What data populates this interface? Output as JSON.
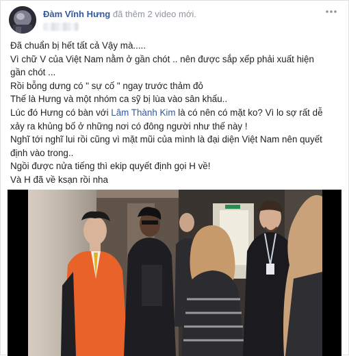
{
  "post": {
    "author": "Đàm Vĩnh Hưng",
    "action": "đã thêm 2 video mới.",
    "more_icon": "ellipsis-icon",
    "lines": {
      "l1": "Đã chuẩn bị hết tất cả Vậy mà.....",
      "l2": "Vì chữ V của Việt Nam nằm ở gần chót .. nên được sắp xếp phải xuất hiện",
      "l3": "gần chót ...",
      "l4": "Rồi bỗng dưng có \" sự cố \" ngay trước thảm đỏ",
      "l5": "Thế là Hưng và một nhóm ca sỹ bị lùa vào sân khấu..",
      "l6_pre": "Lúc đó Hưng có bàn với ",
      "l6_link": "Lâm Thành Kim",
      "l6_post": " là có nên có mặt ko? Vì lo sợ rất dễ",
      "l7": "xảy ra khủng bố ở những nơi có đông người như thế này !",
      "l8": "Nghĩ tới nghĩ lui rồi cũng vì mặt mũi của mình là đại diện Việt Nam nên quyết",
      "l9": "định vào trong..",
      "l10": "Ngồi được nửa tiếng thì ekip quyết định gọi H về!",
      "l11": "Và H đã về ksạn rồi nha"
    }
  },
  "colors": {
    "link": "#365899",
    "meta": "#90949c",
    "text": "#1c1e21",
    "orange_jacket": "#e8622a"
  }
}
